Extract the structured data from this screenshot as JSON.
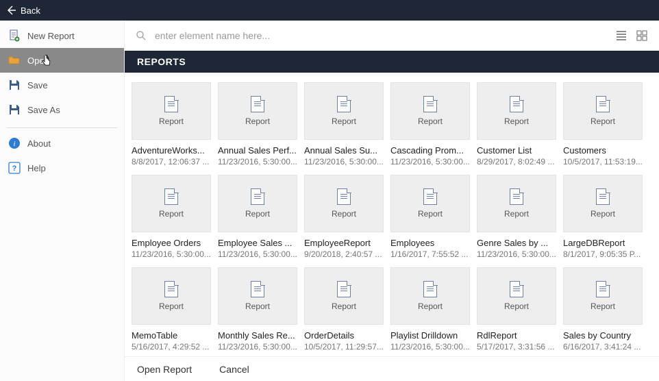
{
  "topbar": {
    "back_label": "Back"
  },
  "sidebar": {
    "items": [
      {
        "id": "new-report",
        "label": "New Report"
      },
      {
        "id": "open",
        "label": "Open",
        "active": true
      },
      {
        "id": "save",
        "label": "Save"
      },
      {
        "id": "save-as",
        "label": "Save As"
      },
      {
        "id": "about",
        "label": "About"
      },
      {
        "id": "help",
        "label": "Help"
      }
    ]
  },
  "search": {
    "placeholder": "enter element name here..."
  },
  "section": {
    "title": "REPORTS"
  },
  "card_type_label": "Report",
  "reports": [
    {
      "name": "AdventureWorks...",
      "date": "8/8/2017, 12:06:37 ..."
    },
    {
      "name": "Annual Sales Perf...",
      "date": "11/23/2016, 5:30:00..."
    },
    {
      "name": "Annual Sales Su...",
      "date": "11/23/2016, 5:30:00..."
    },
    {
      "name": "Cascading Prom...",
      "date": "11/23/2016, 5:30:00..."
    },
    {
      "name": "Customer List",
      "date": "8/29/2017, 8:02:49 ..."
    },
    {
      "name": "Customers",
      "date": "10/5/2017, 11:53:19..."
    },
    {
      "name": "Employee Orders",
      "date": "11/23/2016, 5:30:00..."
    },
    {
      "name": "Employee Sales ...",
      "date": "11/23/2016, 5:30:00..."
    },
    {
      "name": "EmployeeReport",
      "date": "9/20/2018, 2:40:57 ..."
    },
    {
      "name": "Employees",
      "date": "1/16/2017, 7:55:52 ..."
    },
    {
      "name": "Genre Sales by ...",
      "date": "11/23/2016, 5:30:00..."
    },
    {
      "name": "LargeDBReport",
      "date": "8/1/2017, 9:05:35 P..."
    },
    {
      "name": "MemoTable",
      "date": "5/16/2017, 4:29:52 ..."
    },
    {
      "name": "Monthly Sales Re...",
      "date": "11/23/2016, 5:30:00..."
    },
    {
      "name": "OrderDetails",
      "date": "10/5/2017, 11:29:57..."
    },
    {
      "name": "Playlist Drilldown",
      "date": "11/23/2016, 5:30:00..."
    },
    {
      "name": "RdlReport",
      "date": "5/17/2017, 3:31:56 ..."
    },
    {
      "name": "Sales by Country",
      "date": "6/16/2017, 3:41:24 ..."
    }
  ],
  "footer": {
    "open_label": "Open Report",
    "cancel_label": "Cancel"
  }
}
